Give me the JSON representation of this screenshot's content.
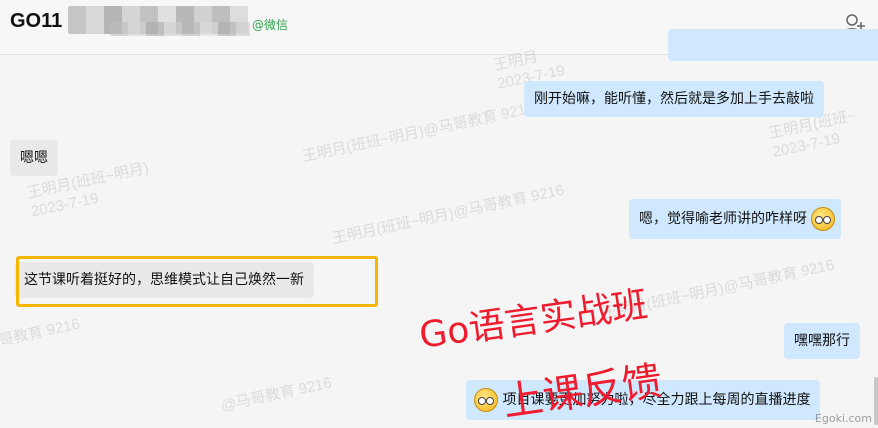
{
  "header": {
    "title": "GO11",
    "wechat_tag": "@微信",
    "add_contact_icon": "add-user-icon"
  },
  "messages": [
    {
      "side": "me",
      "text": "刚开始嘛，能听懂，然后就是多加上手去敲啦"
    },
    {
      "side": "other",
      "text": "嗯嗯"
    },
    {
      "side": "me",
      "text": "嗯，觉得喻老师讲的咋样呀",
      "emoji_after": "thinking-emoji"
    },
    {
      "side": "other",
      "text": "这节课听着挺好的，思维模式让自己焕然一新",
      "highlighted": true
    },
    {
      "side": "me",
      "text": "嘿嘿那行"
    },
    {
      "side": "me",
      "text": "项目课要更加努力啦，尽全力跟上每周的直播进度",
      "emoji_before": "thinking-emoji"
    }
  ],
  "overlay": {
    "line1": "Go语言实战班",
    "line2": "上课反馈",
    "color": "#ee1c2e"
  },
  "watermarks": {
    "w1": "王明月\n2023-7-19",
    "w2": "王明月(班班~明月)@马哥教育 9216",
    "w3": "王明月(班班~\n2023-7-19",
    "w4": "王明月(班班~明月)\n2023-7-19",
    "w5": "王明月(班班~明月)@马哥教育 9216",
    "w6": "王明月(班班~明月)@马哥教育 9216",
    "w7": "哥教育 9216",
    "w8": "@马哥教育 9216"
  },
  "site_mark": "Egoki.com",
  "colors": {
    "my_bubble": "#cfe8fd",
    "other_bubble": "#e9e9e9",
    "highlight_border": "#f5b700"
  }
}
